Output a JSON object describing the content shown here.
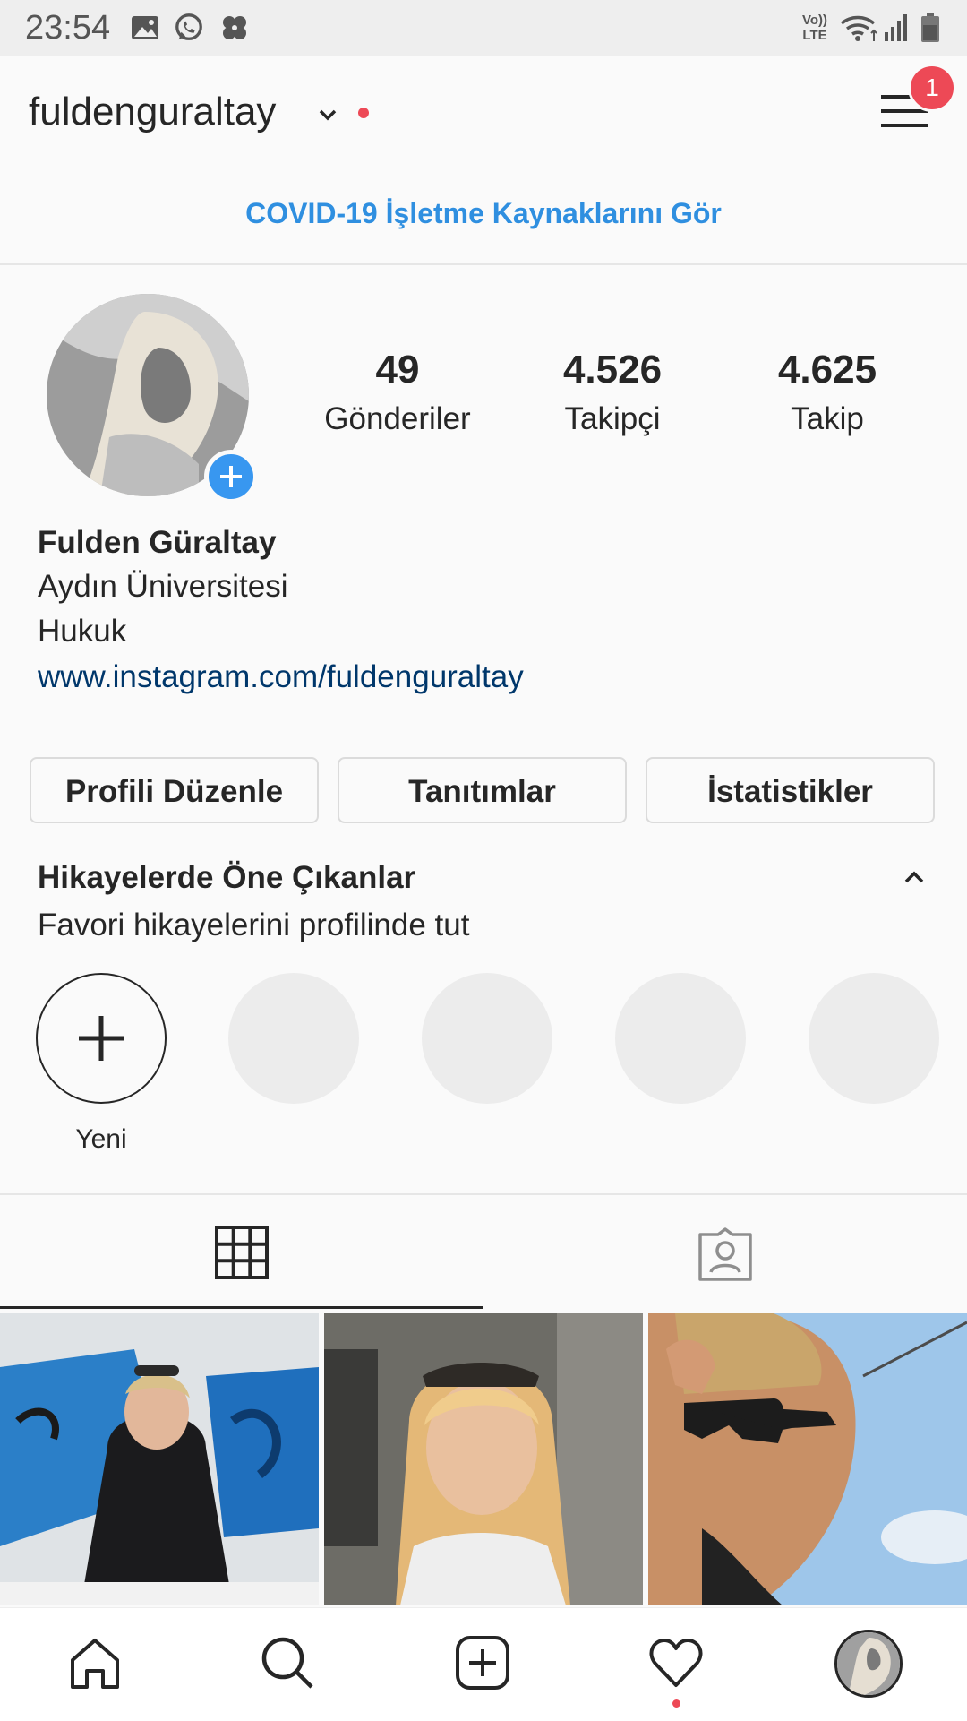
{
  "status_bar": {
    "time": "23:54",
    "left_icons": [
      "image-icon",
      "whatsapp-icon",
      "pinwheel-icon"
    ],
    "right_icons": [
      "volte-icon",
      "wifi-icon",
      "signal-icon",
      "battery-icon"
    ],
    "volte_text_top": "Vo))",
    "volte_text_bottom": "LTE"
  },
  "header": {
    "username": "fuldenguraltay",
    "notification_count": "1",
    "accent_red": "#ed4956"
  },
  "covid_banner": {
    "text": "COVID-19 İşletme Kaynaklarını Gör"
  },
  "profile": {
    "stats": [
      {
        "value": "49",
        "label": "Gönderiler"
      },
      {
        "value": "4.526",
        "label": "Takipçi"
      },
      {
        "value": "4.625",
        "label": "Takip"
      }
    ],
    "name": "Fulden Güraltay",
    "bio_lines": [
      "Aydın Üniversitesi",
      "Hukuk"
    ],
    "website": "www.instagram.com/fuldenguraltay"
  },
  "buttons": {
    "edit_profile": "Profili Düzenle",
    "promotions": "Tanıtımlar",
    "insights": "İstatistikler"
  },
  "highlights": {
    "title": "Hikayelerde Öne Çıkanlar",
    "subtitle": "Favori hikayelerini profilinde tut",
    "new_label": "Yeni"
  },
  "tabs": [
    "grid-icon",
    "tagged-icon"
  ],
  "bottom_nav": [
    "home-icon",
    "search-icon",
    "add-post-icon",
    "activity-heart-icon",
    "profile-avatar"
  ],
  "colors": {
    "link_blue": "#2f8fe0",
    "add_blue": "#3897f0",
    "website_blue": "#00376b"
  }
}
